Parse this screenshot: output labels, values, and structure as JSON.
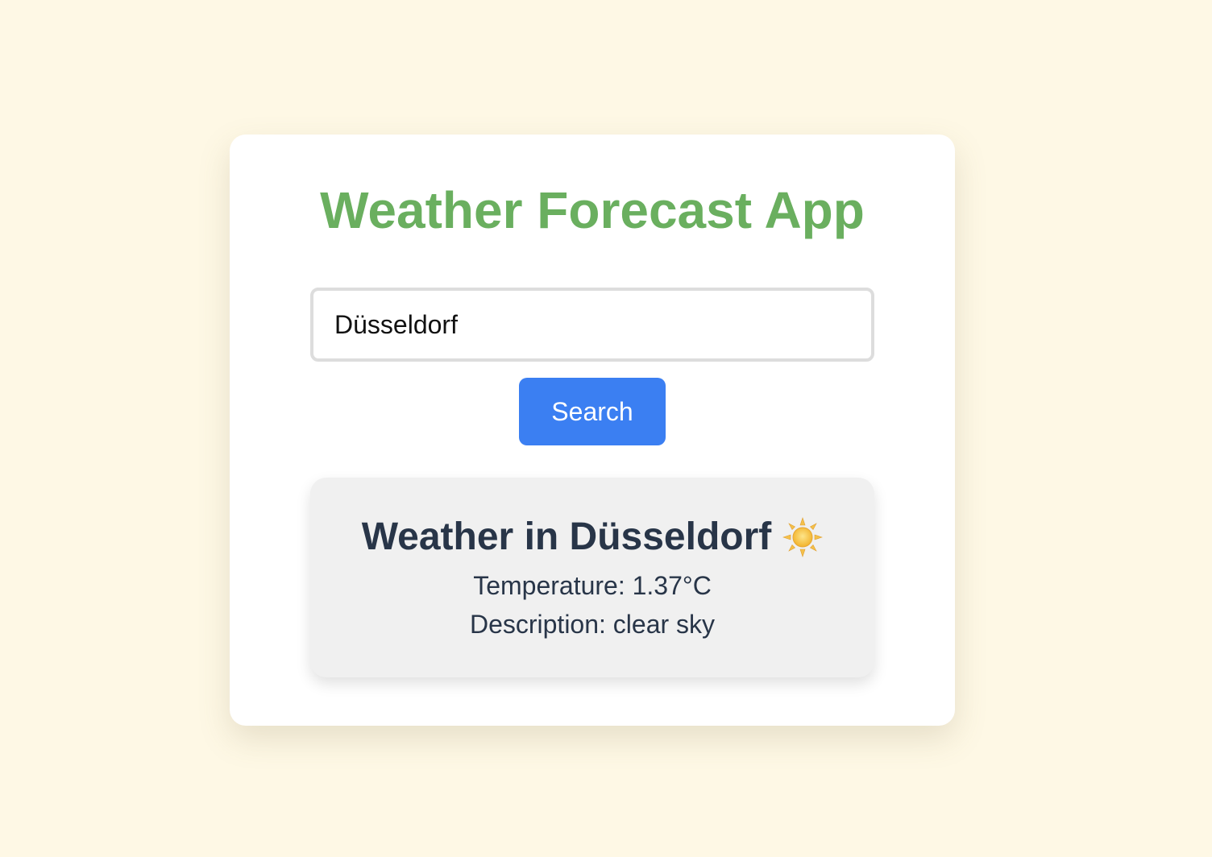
{
  "app": {
    "title": "Weather Forecast App",
    "title_color": "#6aaf5f",
    "background_color": "#fef8e5"
  },
  "search": {
    "value": "Düsseldorf",
    "button_label": "Search",
    "button_color": "#3b7ff2"
  },
  "result": {
    "heading": "Weather in Düsseldorf",
    "weather_icon": "sun-icon",
    "temperature_text": "Temperature: 1.37°C",
    "description_text": "Description: clear sky"
  }
}
